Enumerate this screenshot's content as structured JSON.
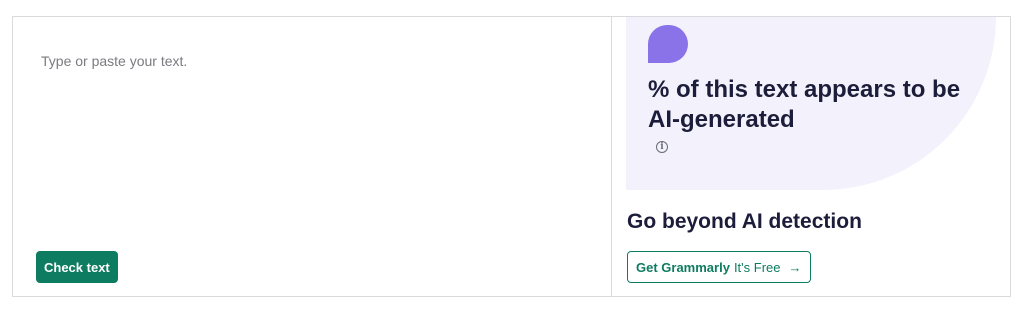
{
  "editor": {
    "placeholder": "Type or paste your text.",
    "value": "",
    "check_button_label": "Check text"
  },
  "result": {
    "heading": "% of this text appears to be AI-generated",
    "info_icon": "info-icon"
  },
  "promo": {
    "heading": "Go beyond AI detection",
    "cta_brand": "Get Grammarly",
    "cta_suffix": "It's Free",
    "cta_icon": "arrow-right-icon",
    "cta_arrow": "→"
  },
  "colors": {
    "brand_green": "#0e7c61",
    "score_purple": "#8a73e8",
    "result_bg": "#f3f2fc",
    "heading_text": "#1c1d3a"
  }
}
